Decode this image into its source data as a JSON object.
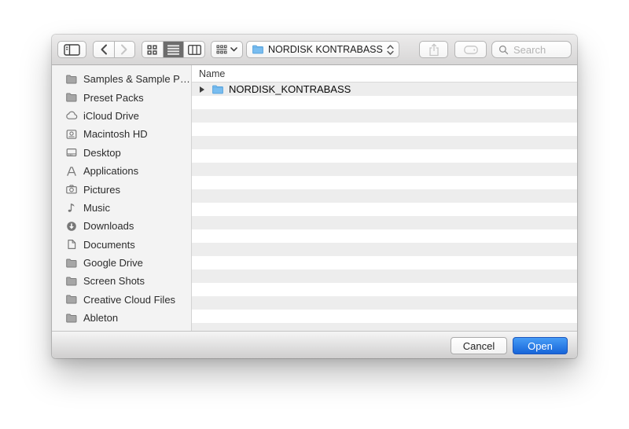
{
  "dialog": {
    "toolbar": {
      "sidebar_toggle": {
        "icon": "sidebar-panel-icon"
      },
      "nav": {
        "back_icon": "chevron-left-icon",
        "forward_icon": "chevron-right-icon",
        "forward_enabled": false
      },
      "views": [
        {
          "name": "icon-view",
          "icon": "grid-view-icon",
          "selected": false
        },
        {
          "name": "list-view",
          "icon": "list-view-icon",
          "selected": true
        },
        {
          "name": "column-view",
          "icon": "column-view-icon",
          "selected": false
        }
      ],
      "arrange_menu": {
        "icon": "arrange-grid-icon",
        "chevron": "chevron-down-icon"
      },
      "location_dropdown": {
        "label": "NORDISK KONTRABASS",
        "icon": "folder-blue-icon",
        "chevron": "updown-chevrons-icon"
      },
      "share": {
        "icon": "share-icon",
        "enabled": false
      },
      "tag": {
        "icon": "tag-icon",
        "enabled": false
      },
      "search": {
        "icon": "magnifier-icon",
        "placeholder": "Search",
        "value": ""
      }
    },
    "sidebar": {
      "items": [
        {
          "label": "Samples & Sample P…",
          "icon": "folder-icon"
        },
        {
          "label": "Preset Packs",
          "icon": "folder-icon"
        },
        {
          "label": "iCloud Drive",
          "icon": "cloud-icon"
        },
        {
          "label": "Macintosh HD",
          "icon": "hdd-icon"
        },
        {
          "label": "Desktop",
          "icon": "desktop-icon"
        },
        {
          "label": "Applications",
          "icon": "applications-icon"
        },
        {
          "label": "Pictures",
          "icon": "pictures-icon"
        },
        {
          "label": "Music",
          "icon": "music-icon"
        },
        {
          "label": "Downloads",
          "icon": "downloads-icon"
        },
        {
          "label": "Documents",
          "icon": "documents-icon"
        },
        {
          "label": "Google Drive",
          "icon": "folder-icon"
        },
        {
          "label": "Screen Shots",
          "icon": "folder-icon"
        },
        {
          "label": "Creative Cloud Files",
          "icon": "folder-icon"
        },
        {
          "label": "Ableton",
          "icon": "folder-icon"
        }
      ]
    },
    "file_list": {
      "columns": [
        "Name"
      ],
      "visible_row_count": 19,
      "entries": [
        {
          "name": "NORDISK_KONTRABASS",
          "icon": "folder-blue-icon",
          "has_disclosure": true,
          "row_index": 0
        }
      ]
    },
    "footer": {
      "cancel_label": "Cancel",
      "open_label": "Open"
    },
    "colors": {
      "open_button_top": "#469cf6",
      "open_button_bottom": "#1765d9",
      "folder_blue": "#79bdf0",
      "folder_blue_edge": "#58a4dd",
      "row_stripe": "#ededed",
      "toolbar_icon_gray": "#3e3e3e",
      "disabled_icon_gray": "#c5c5c5"
    }
  }
}
